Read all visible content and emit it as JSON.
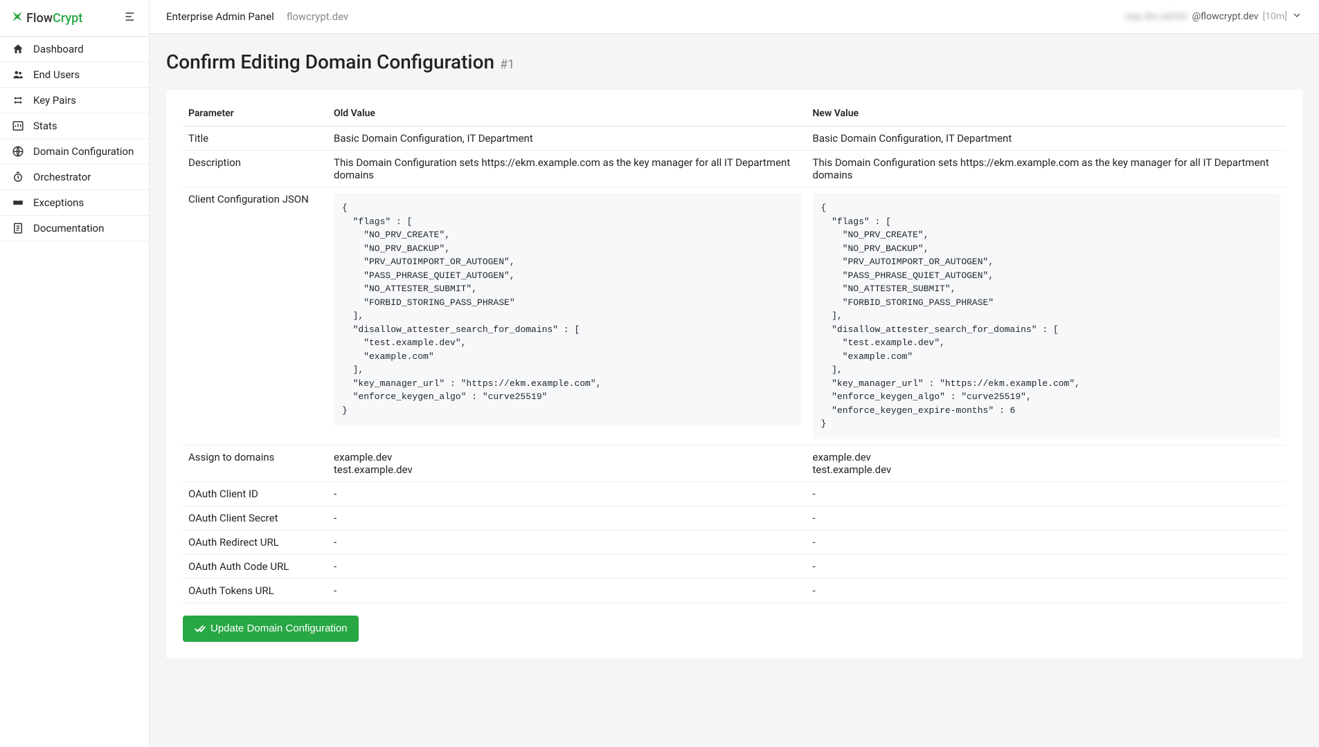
{
  "brand": {
    "flow": "Flow",
    "crypt": "Crypt"
  },
  "sidebar": {
    "items": [
      {
        "label": "Dashboard"
      },
      {
        "label": "End Users"
      },
      {
        "label": "Key Pairs"
      },
      {
        "label": "Stats"
      },
      {
        "label": "Domain Configuration"
      },
      {
        "label": "Orchestrator"
      },
      {
        "label": "Exceptions"
      },
      {
        "label": "Documentation"
      }
    ]
  },
  "topbar": {
    "panel_title": "Enterprise Admin Panel",
    "panel_domain": "flowcrypt.dev",
    "user_blur": "eap.dev.admin",
    "user_domain": "@flowcrypt.dev",
    "user_time": "[10m]"
  },
  "page": {
    "title": "Confirm Editing Domain Configuration",
    "title_num": "#1"
  },
  "table": {
    "headers": {
      "param": "Parameter",
      "old": "Old Value",
      "new": "New Value"
    },
    "rows": [
      {
        "param": "Title",
        "old": "Basic Domain Configuration, IT Department",
        "new": "Basic Domain Configuration, IT Department"
      },
      {
        "param": "Description",
        "old": "This Domain Configuration sets https://ekm.example.com as the key manager for all IT Department domains",
        "new": "This Domain Configuration sets https://ekm.example.com as the key manager for all IT Department domains"
      },
      {
        "param": "Client Configuration JSON",
        "old_code": "{\n  \"flags\" : [\n    \"NO_PRV_CREATE\",\n    \"NO_PRV_BACKUP\",\n    \"PRV_AUTOIMPORT_OR_AUTOGEN\",\n    \"PASS_PHRASE_QUIET_AUTOGEN\",\n    \"NO_ATTESTER_SUBMIT\",\n    \"FORBID_STORING_PASS_PHRASE\"\n  ],\n  \"disallow_attester_search_for_domains\" : [\n    \"test.example.dev\",\n    \"example.com\"\n  ],\n  \"key_manager_url\" : \"https://ekm.example.com\",\n  \"enforce_keygen_algo\" : \"curve25519\"\n}",
        "new_code": "{\n  \"flags\" : [\n    \"NO_PRV_CREATE\",\n    \"NO_PRV_BACKUP\",\n    \"PRV_AUTOIMPORT_OR_AUTOGEN\",\n    \"PASS_PHRASE_QUIET_AUTOGEN\",\n    \"NO_ATTESTER_SUBMIT\",\n    \"FORBID_STORING_PASS_PHRASE\"\n  ],\n  \"disallow_attester_search_for_domains\" : [\n    \"test.example.dev\",\n    \"example.com\"\n  ],\n  \"key_manager_url\" : \"https://ekm.example.com\",\n  \"enforce_keygen_algo\" : \"curve25519\",\n  \"enforce_keygen_expire-months\" : 6\n}"
      },
      {
        "param": "Assign to domains",
        "old": "example.dev\ntest.example.dev",
        "new": "example.dev\ntest.example.dev"
      },
      {
        "param": "OAuth Client ID",
        "old": "-",
        "new": "-"
      },
      {
        "param": "OAuth Client Secret",
        "old": "-",
        "new": "-"
      },
      {
        "param": "OAuth Redirect URL",
        "old": "-",
        "new": "-"
      },
      {
        "param": "OAuth Auth Code URL",
        "old": "-",
        "new": "-"
      },
      {
        "param": "OAuth Tokens URL",
        "old": "-",
        "new": "-"
      }
    ]
  },
  "actions": {
    "update_label": "Update Domain Configuration"
  }
}
